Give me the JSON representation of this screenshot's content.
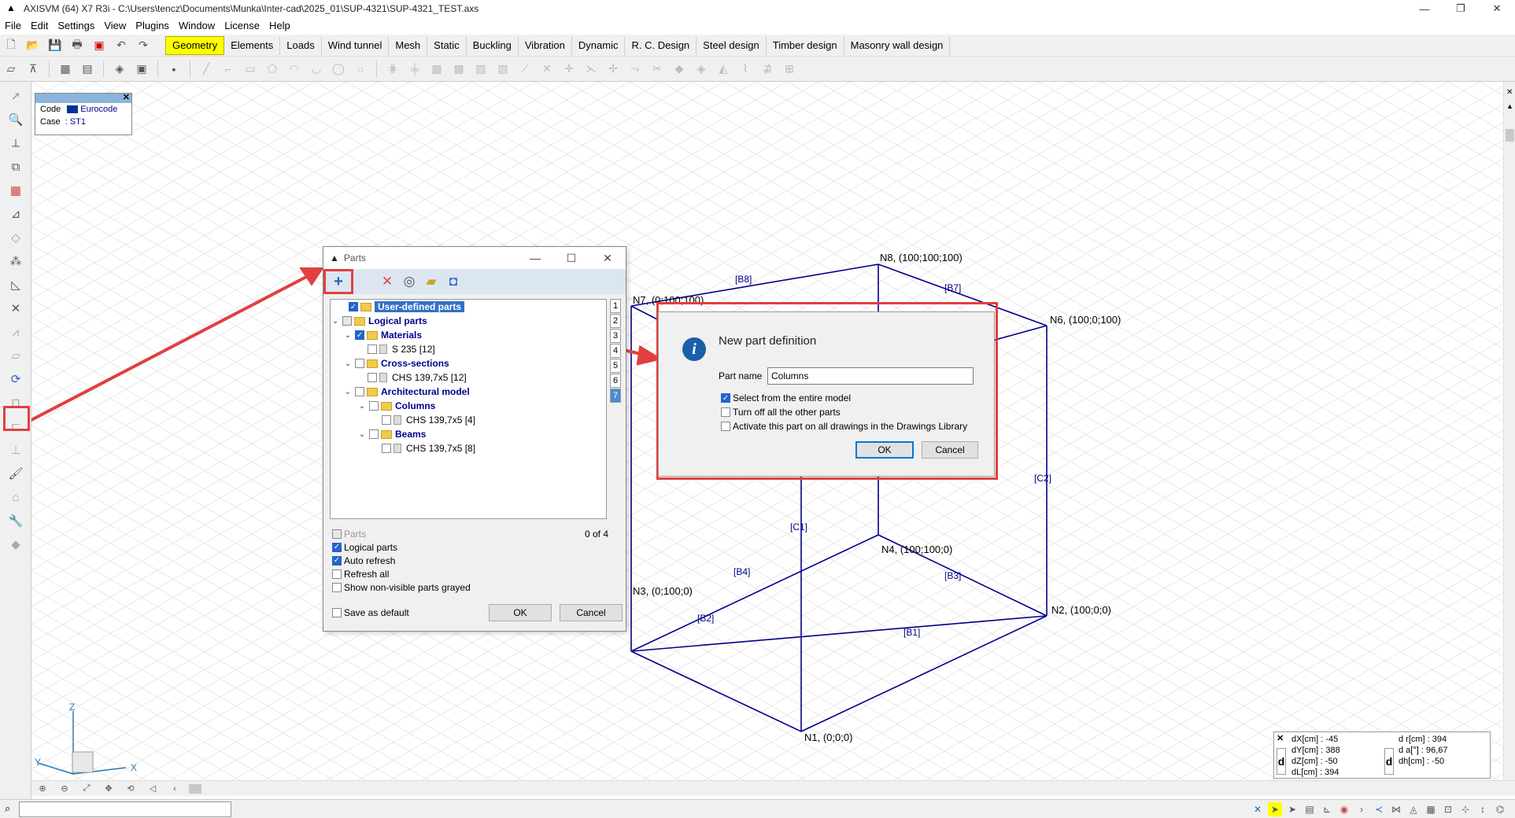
{
  "app": {
    "title": "AXISVM (64) X7 R3i - C:\\Users\\tencz\\Documents\\Munka\\Inter-cad\\2025_01\\SUP-4321\\SUP-4321_TEST.axs"
  },
  "menu": [
    "File",
    "Edit",
    "Settings",
    "View",
    "Plugins",
    "Window",
    "License",
    "Help"
  ],
  "tabs": [
    "Geometry",
    "Elements",
    "Loads",
    "Wind tunnel",
    "Mesh",
    "Static",
    "Buckling",
    "Vibration",
    "Dynamic",
    "R. C. Design",
    "Steel design",
    "Timber design",
    "Masonry wall design"
  ],
  "active_tab": "Geometry",
  "code_box": {
    "code_label": "Code",
    "code_value": "Eurocode",
    "case_label": "Case",
    "case_value": ": ST1"
  },
  "parts_dialog": {
    "title": "Parts",
    "tree": [
      {
        "label": "User-defined parts",
        "level": 0
      },
      {
        "label": "Logical parts",
        "level": 0
      },
      {
        "label": "Materials",
        "level": 1
      },
      {
        "label": "S 235  [12]",
        "level": 2
      },
      {
        "label": "Cross-sections",
        "level": 1
      },
      {
        "label": "CHS 139,7x5  [12]",
        "level": 2
      },
      {
        "label": "Architectural model",
        "level": 1
      },
      {
        "label": "Columns",
        "level": 2
      },
      {
        "label": "CHS 139,7x5  [4]",
        "level": 3
      },
      {
        "label": "Beams",
        "level": 2
      },
      {
        "label": "CHS 139,7x5  [8]",
        "level": 3
      }
    ],
    "levels": [
      "1",
      "2",
      "3",
      "4",
      "5",
      "6",
      "7"
    ],
    "options": {
      "parts": "Parts",
      "logical_parts": "Logical parts",
      "auto_refresh": "Auto refresh",
      "refresh_all": "Refresh all",
      "show_nonvisible": "Show non-visible parts grayed"
    },
    "counter": "0 of 4",
    "save_default": "Save as default",
    "ok": "OK",
    "cancel": "Cancel"
  },
  "new_part_dialog": {
    "heading": "New part definition",
    "name_label": "Part name",
    "name_value": "Columns",
    "opt_select_entire": "Select from the entire model",
    "opt_turn_off": "Turn off all the other parts",
    "opt_activate": "Activate this part on all drawings in the Drawings Library",
    "ok": "OK",
    "cancel": "Cancel"
  },
  "model": {
    "nodes": [
      {
        "label": "N1, (0;0;0)"
      },
      {
        "label": "N2, (100;0;0)"
      },
      {
        "label": "N3, (0;100;0)"
      },
      {
        "label": "N4, (100;100;0)"
      },
      {
        "label": "N6, (100;0;100)"
      },
      {
        "label": "N7, (0;100;100)"
      },
      {
        "label": "N8, (100;100;100)"
      }
    ],
    "members": [
      "[B1]",
      "[B2]",
      "[B3]",
      "[B4]",
      "[B7]",
      "[B8]",
      "[C1]",
      "[C2]"
    ]
  },
  "axes": {
    "x": "X",
    "y": "Y",
    "z": "Z"
  },
  "coords": {
    "dx": "dX[cm] : -45",
    "dy": "dY[cm] : 388",
    "dz": "dZ[cm] : -50",
    "dl": "dL[cm] : 394",
    "dr": "d r[cm] : 394",
    "da": "d   a[°] : 96,67",
    "dh": "dh[cm] : -50",
    "d_label": "d"
  },
  "colors": {
    "accent": "#ffff00",
    "model_line": "#00008b",
    "callout": "#e04040"
  }
}
